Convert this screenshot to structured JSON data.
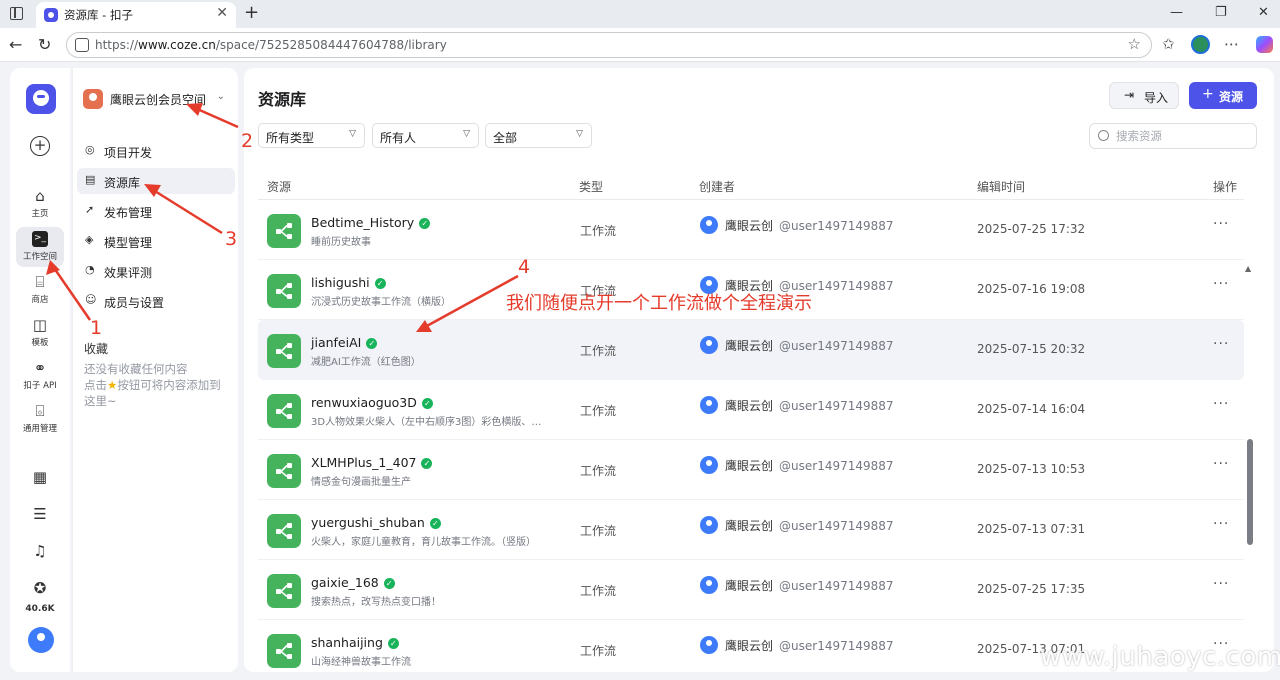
{
  "browser": {
    "tab_title": "资源库 - 扣子",
    "url_prefix": "https://",
    "url_host": "www.coze.cn",
    "url_path": "/space/7525285084447604788/library"
  },
  "rail": {
    "items": [
      {
        "label": "主页"
      },
      {
        "label": "工作空间"
      },
      {
        "label": "商店"
      },
      {
        "label": "模板"
      },
      {
        "label": "扣子 API"
      },
      {
        "label": "通用管理"
      }
    ],
    "count": "40.6K"
  },
  "sidebar": {
    "workspace": "鹰眼云创会员空间",
    "nav": [
      {
        "label": "项目开发"
      },
      {
        "label": "资源库"
      },
      {
        "label": "发布管理"
      },
      {
        "label": "模型管理"
      },
      {
        "label": "效果评测"
      },
      {
        "label": "成员与设置"
      }
    ],
    "favorites_title": "收藏",
    "favorites_empty_1": "还没有收藏任何内容",
    "favorites_empty_2a": "点击",
    "favorites_empty_2b": "按钮可将内容添加到",
    "favorites_empty_3": "这里~"
  },
  "main": {
    "title": "资源库",
    "import_label": "导入",
    "add_label": "资源",
    "filters": [
      "所有类型",
      "所有人",
      "全部"
    ],
    "search_placeholder": "搜索资源",
    "columns": {
      "resource": "资源",
      "type": "类型",
      "creator": "创建者",
      "edited": "编辑时间",
      "actions": "操作"
    },
    "rows": [
      {
        "name": "Bedtime_History",
        "desc": "睡前历史故事",
        "type": "工作流",
        "creator": "鹰眼云创",
        "user": "@user1497149887",
        "time": "2025-07-25 17:32"
      },
      {
        "name": "lishigushi",
        "desc": "沉浸式历史故事工作流（横版）",
        "type": "工作流",
        "creator": "鹰眼云创",
        "user": "@user1497149887",
        "time": "2025-07-16 19:08"
      },
      {
        "name": "jianfeiAI",
        "desc": "减肥AI工作流（红色图）",
        "type": "工作流",
        "creator": "鹰眼云创",
        "user": "@user1497149887",
        "time": "2025-07-15 20:32"
      },
      {
        "name": "renwuxiaoguo3D",
        "desc": "3D人物效果火柴人（左中右顺序3图）彩色横版、…",
        "type": "工作流",
        "creator": "鹰眼云创",
        "user": "@user1497149887",
        "time": "2025-07-14 16:04"
      },
      {
        "name": "XLMHPlus_1_407",
        "desc": "情感金句漫画批量生产",
        "type": "工作流",
        "creator": "鹰眼云创",
        "user": "@user1497149887",
        "time": "2025-07-13 10:53"
      },
      {
        "name": "yuergushi_shuban",
        "desc": "火柴人，家庭儿童教育，育儿故事工作流。（竖版）",
        "type": "工作流",
        "creator": "鹰眼云创",
        "user": "@user1497149887",
        "time": "2025-07-13 07:31"
      },
      {
        "name": "gaixie_168",
        "desc": "搜索热点，改写热点变口播！",
        "type": "工作流",
        "creator": "鹰眼云创",
        "user": "@user1497149887",
        "time": "2025-07-25 17:35"
      },
      {
        "name": "shanhaijing",
        "desc": "山海经神兽故事工作流",
        "type": "工作流",
        "creator": "鹰眼云创",
        "user": "@user1497149887",
        "time": "2025-07-13 07:01"
      }
    ]
  },
  "annotations": {
    "n1": "1",
    "n2": "2",
    "n3": "3",
    "n4": "4",
    "note": "我们随便点开一个工作流做个全程演示",
    "color": "#e53b2b"
  },
  "watermark": "www.juhaoyc.com",
  "colors": {
    "accent": "#4d53e8",
    "workflow_icon": "#45b35c",
    "verified": "#18b35a"
  }
}
